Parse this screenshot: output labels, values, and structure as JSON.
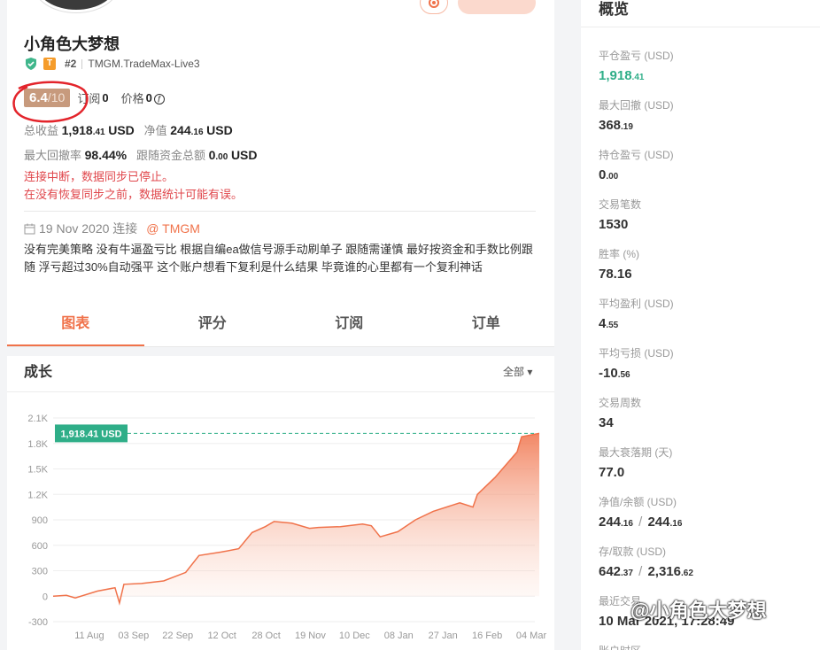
{
  "profile": {
    "name": "小角色大梦想",
    "t_badge": "T",
    "rank": "#2",
    "server": "TMGM.TradeMax-Live3",
    "score": "6.4",
    "score_max": "/10",
    "subscriptions_label": "订阅",
    "subscriptions_value": "0",
    "price_label": "价格",
    "price_value": "0",
    "total_profit_label": "总收益",
    "total_profit_main": "1,918",
    "total_profit_dec": ".41",
    "total_profit_unit": "USD",
    "equity_label": "净值",
    "equity_main": "244",
    "equity_dec": ".16",
    "equity_unit": "USD",
    "max_dd_rate_label": "最大回撤率",
    "max_dd_rate_value": "98.44%",
    "follow_total_label": "跟随资金总额",
    "follow_total_main": "0",
    "follow_total_dec": ".00",
    "follow_total_unit": "USD",
    "warning_1": "连接中断，数据同步已停止。",
    "warning_2": "在没有恢复同步之前，数据统计可能有误。",
    "connect_date": "19 Nov 2020 连接",
    "broker": "@ TMGM",
    "description": "没有完美策略 没有牛逼盈亏比 根据自编ea做信号源手动刷单子 跟随需谨慎 最好按资金和手数比例跟随 浮亏超过30%自动强平 这个账户想看下复利是什么结果 毕竟谁的心里都有一个复利神话"
  },
  "tabs": [
    {
      "label": "图表",
      "active": true
    },
    {
      "label": "评分",
      "active": false
    },
    {
      "label": "订阅",
      "active": false
    },
    {
      "label": "订单",
      "active": false
    }
  ],
  "growth": {
    "title": "成长",
    "filter": "全部 ▾"
  },
  "chart_data": {
    "type": "area",
    "y_ticks": [
      "2.1K",
      "1.8K",
      "1.5K",
      "1.2K",
      "900",
      "600",
      "300",
      "0",
      "-300"
    ],
    "ylim": [
      -300,
      2100
    ],
    "x_ticks": [
      "11 Aug",
      "03 Sep",
      "22 Sep",
      "12 Oct",
      "28 Oct",
      "19 Nov",
      "10 Dec",
      "08 Jan",
      "27 Jan",
      "16 Feb",
      "04 Mar"
    ],
    "current_label": "1,918.41 USD",
    "current_value": 1918.41,
    "line_color": "#f0724a",
    "points": [
      [
        0,
        0
      ],
      [
        0.3,
        10
      ],
      [
        0.5,
        -20
      ],
      [
        1,
        60
      ],
      [
        1.4,
        100
      ],
      [
        1.5,
        -80
      ],
      [
        1.6,
        140
      ],
      [
        2,
        150
      ],
      [
        2.5,
        180
      ],
      [
        3,
        280
      ],
      [
        3.3,
        480
      ],
      [
        3.8,
        520
      ],
      [
        4.2,
        560
      ],
      [
        4.5,
        750
      ],
      [
        4.8,
        820
      ],
      [
        5,
        880
      ],
      [
        5.4,
        860
      ],
      [
        5.8,
        800
      ],
      [
        6,
        810
      ],
      [
        6.5,
        820
      ],
      [
        7,
        850
      ],
      [
        7.2,
        830
      ],
      [
        7.4,
        700
      ],
      [
        7.8,
        760
      ],
      [
        8.2,
        900
      ],
      [
        8.6,
        1000
      ],
      [
        9.2,
        1100
      ],
      [
        9.5,
        1050
      ],
      [
        9.6,
        1200
      ],
      [
        10,
        1400
      ],
      [
        10.5,
        1700
      ],
      [
        10.6,
        1880
      ],
      [
        11,
        1918
      ]
    ]
  },
  "overview": {
    "title": "概览",
    "metrics": [
      {
        "label": "平仓盈亏 (USD)",
        "main": "1,918",
        "dec": ".41",
        "green": true
      },
      {
        "label": "最大回撤 (USD)",
        "main": "368",
        "dec": ".19",
        "green": false
      },
      {
        "label": "持仓盈亏 (USD)",
        "main": "0",
        "dec": ".00",
        "green": false
      },
      {
        "label": "交易笔数",
        "main": "1530",
        "dec": "",
        "green": false
      },
      {
        "label": "胜率 (%)",
        "main": "78.16",
        "dec": "",
        "green": false
      },
      {
        "label": "平均盈利 (USD)",
        "main": "4",
        "dec": ".55",
        "green": false
      },
      {
        "label": "平均亏损 (USD)",
        "main": "-10",
        "dec": ".56",
        "green": false
      },
      {
        "label": "交易周数",
        "main": "34",
        "dec": "",
        "green": false
      },
      {
        "label": "最大衰落期 (天)",
        "main": "77.0",
        "dec": "",
        "green": false
      },
      {
        "label": "净值/余额 (USD)",
        "main": "244",
        "dec": ".16",
        "main2": "244",
        "dec2": ".16",
        "green": false
      },
      {
        "label": "存/取款 (USD)",
        "main": "642",
        "dec": ".37",
        "main2": "2,316",
        "dec2": ".62",
        "green": false
      },
      {
        "label": "最近交易",
        "main": "10 Mar 2021, 17:28:49",
        "dec": "",
        "green": false
      },
      {
        "label": "账户时区",
        "main": "",
        "dec": "",
        "green": false
      }
    ]
  },
  "watermark": "@小角色大梦想"
}
